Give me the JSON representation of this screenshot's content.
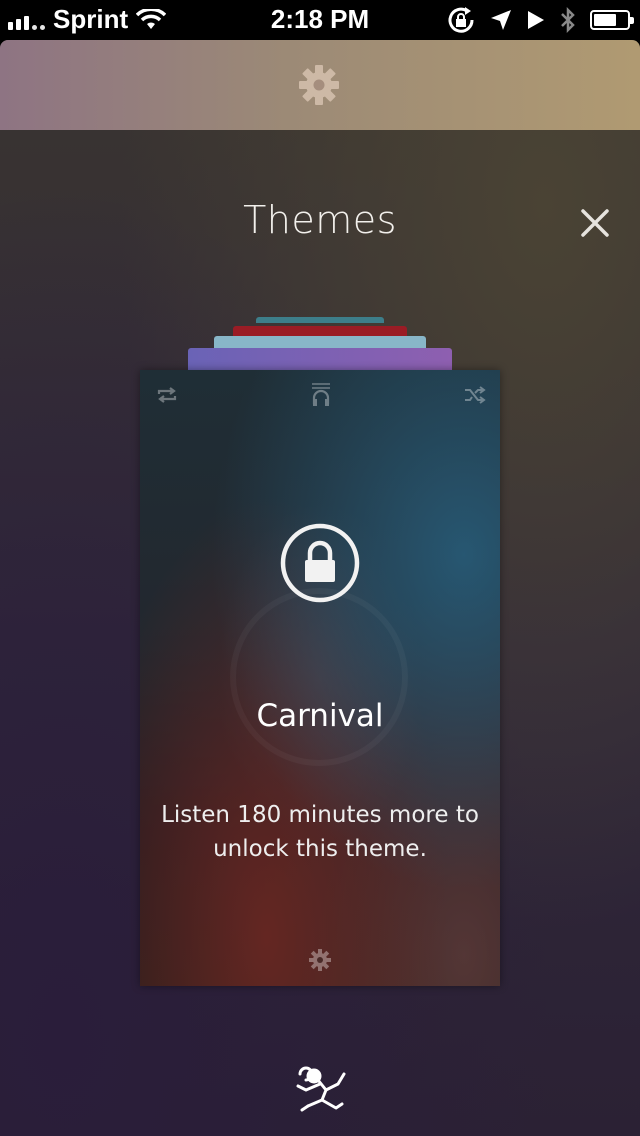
{
  "status_bar": {
    "carrier": "Sprint",
    "time": "2:18 PM",
    "icons": [
      "signal-icon",
      "wifi-icon",
      "rotation-lock-icon",
      "location-icon",
      "play-icon",
      "bluetooth-icon",
      "battery-icon"
    ]
  },
  "header": {
    "settings_icon": "gear-icon"
  },
  "themes": {
    "title": "Themes",
    "close_icon": "close-icon"
  },
  "card": {
    "icons": [
      "repeat-icon",
      "headphone-icon",
      "shuffle-icon",
      "lock-icon",
      "gear-icon"
    ],
    "theme_name": "Carnival",
    "unlock_message": "Listen 180 minutes more to unlock this theme."
  },
  "footer": {
    "logo_icon": "monkey-logo-icon"
  },
  "colors": {
    "header_gradient_start": "#8e7483",
    "header_gradient_end": "#b09a72",
    "background": "#30283a"
  }
}
